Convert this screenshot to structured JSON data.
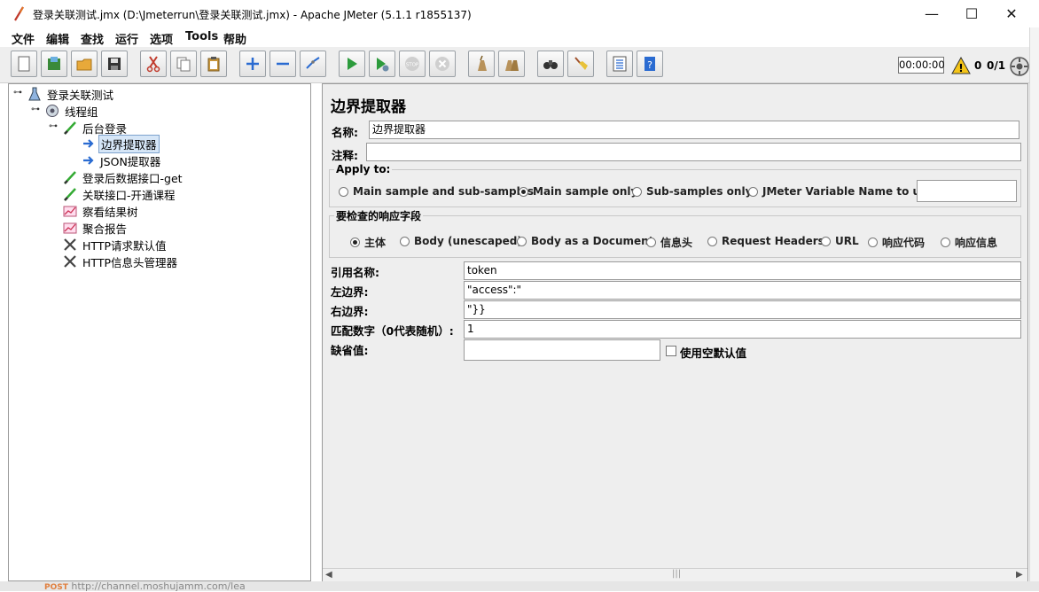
{
  "window": {
    "title": "登录关联测试.jmx (D:\\Jmeterrun\\登录关联测试.jmx) - Apache JMeter (5.1.1 r1855137)",
    "controls": {
      "minimize": "—",
      "maximize": "☐",
      "close": "✕"
    }
  },
  "menu": [
    "文件",
    "编辑",
    "查找",
    "运行",
    "选项",
    "Tools",
    "帮助"
  ],
  "toolbar": {
    "buttons": [
      "new-icon",
      "templates-icon",
      "open-icon",
      "save-icon",
      "cut-icon",
      "copy-icon",
      "paste-icon",
      "expand-icon",
      "collapse-icon",
      "toggle-icon",
      "start-icon",
      "start-no-pause-icon",
      "stop-icon",
      "shutdown-icon",
      "clear-icon",
      "clear-all-icon",
      "search-icon",
      "reset-search-icon",
      "function-helper-icon",
      "help-icon"
    ],
    "timer": "00:00:00",
    "warnings": "0",
    "threads": "0/1"
  },
  "tree": [
    {
      "label": "登录关联测试",
      "icon": "test-plan-icon",
      "level": 0
    },
    {
      "label": "线程组",
      "icon": "thread-group-icon",
      "level": 1
    },
    {
      "label": "后台登录",
      "icon": "sampler-icon",
      "level": 2
    },
    {
      "label": "边界提取器",
      "icon": "extractor-icon",
      "level": 3,
      "selected": true
    },
    {
      "label": "JSON提取器",
      "icon": "extractor-icon",
      "level": 3
    },
    {
      "label": "登录后数据接口-get",
      "icon": "sampler-icon",
      "level": 2
    },
    {
      "label": "关联接口-开通课程",
      "icon": "sampler-icon",
      "level": 2
    },
    {
      "label": "察看结果树",
      "icon": "listener-icon",
      "level": 2
    },
    {
      "label": "聚合报告",
      "icon": "listener-icon",
      "level": 2
    },
    {
      "label": "HTTP请求默认值",
      "icon": "config-icon",
      "level": 2
    },
    {
      "label": "HTTP信息头管理器",
      "icon": "config-icon",
      "level": 2
    }
  ],
  "panel": {
    "title": "边界提取器",
    "name_label": "名称:",
    "name_value": "边界提取器",
    "comment_label": "注释:",
    "comment_value": "",
    "apply_to": {
      "legend": "Apply to:",
      "options": [
        "Main sample and sub-samples",
        "Main sample only",
        "Sub-samples only",
        "JMeter Variable Name to use"
      ],
      "selected": 1,
      "var_value": ""
    },
    "field_check": {
      "legend": "要检查的响应字段",
      "options": [
        "主体",
        "Body (unescaped)",
        "Body as a Document",
        "信息头",
        "Request Headers",
        "URL",
        "响应代码",
        "响应信息"
      ],
      "selected": 0
    },
    "ref_label": "引用名称:",
    "ref_value": "token",
    "left_label": "左边界:",
    "left_value": "\"access\":\"",
    "right_label": "右边界:",
    "right_value": "\"}}",
    "match_label": "匹配数字（0代表随机）:",
    "match_value": "1",
    "default_label": "缺省值:",
    "default_value": "",
    "empty_default_label": "使用空默认值"
  },
  "background": {
    "peek_text": "http://channel.moshujamm.com/lea",
    "peek_method": "POST"
  }
}
